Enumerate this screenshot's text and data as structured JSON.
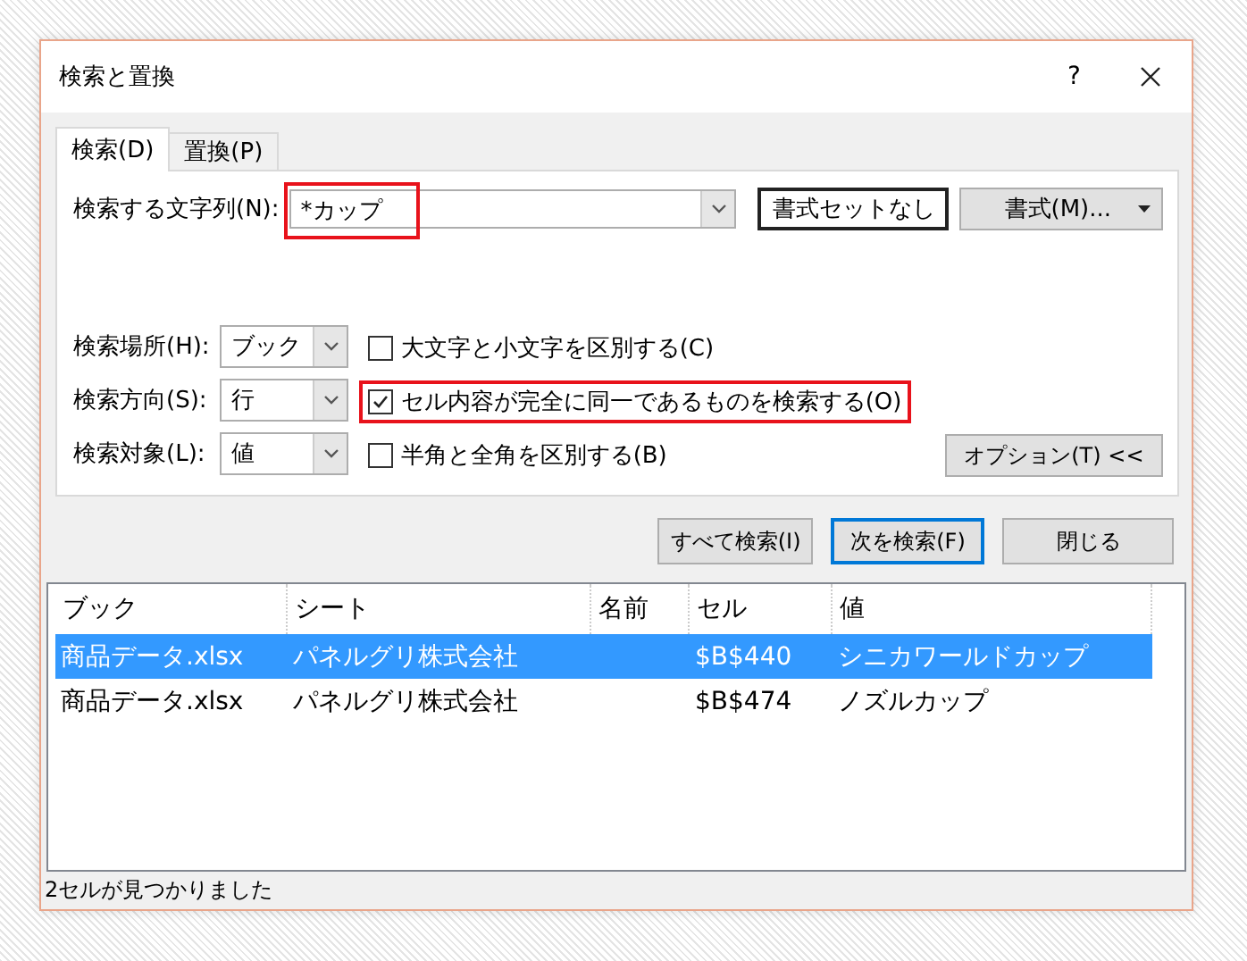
{
  "window": {
    "title": "検索と置換",
    "help": "?"
  },
  "tabs": [
    {
      "label": "検索(D)",
      "selected": true
    },
    {
      "label": "置換(P)",
      "selected": false
    }
  ],
  "find": {
    "label": "検索する文字列(N):",
    "value": "*カップ",
    "highlighted": true
  },
  "format_preview": "書式セットなし",
  "format_button": "書式(M)...",
  "selects": [
    {
      "label": "検索場所(H):",
      "value": "ブック"
    },
    {
      "label": "検索方向(S):",
      "value": "行"
    },
    {
      "label": "検索対象(L):",
      "value": "値"
    }
  ],
  "checkboxes": [
    {
      "label": "大文字と小文字を区別する(C)",
      "checked": false,
      "highlighted": false
    },
    {
      "label": "セル内容が完全に同一であるものを検索する(O)",
      "checked": true,
      "highlighted": true
    },
    {
      "label": "半角と全角を区別する(B)",
      "checked": false,
      "highlighted": false
    }
  ],
  "options_button": "オプション(T) <<",
  "buttons": [
    {
      "label": "すべて検索(I)",
      "default": false
    },
    {
      "label": "次を検索(F)",
      "default": true
    },
    {
      "label": "閉じる",
      "default": false
    }
  ],
  "results": {
    "columns": [
      "ブック",
      "シート",
      "名前",
      "セル",
      "値"
    ],
    "rows": [
      {
        "cells": [
          "商品データ.xlsx",
          "パネルグリ株式会社",
          "",
          "$B$440",
          "シニカワールドカップ"
        ],
        "selected": true
      },
      {
        "cells": [
          "商品データ.xlsx",
          "パネルグリ株式会社",
          "",
          "$B$474",
          "ノズルカップ"
        ],
        "selected": false
      }
    ]
  },
  "status_bar": "2セルが見つかりました"
}
